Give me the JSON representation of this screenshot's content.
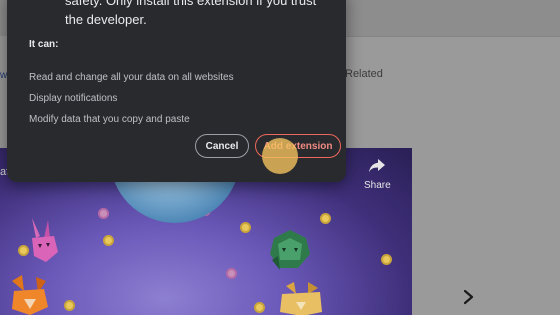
{
  "background_page": {
    "related_label": "Related",
    "left_fragment": "w",
    "video": {
      "title_fragment": "at",
      "share_label": "Share",
      "share_icon": "share-arrow-icon",
      "play_icon": "youtube-play-icon",
      "next_icon": "chevron-right-icon"
    }
  },
  "dialog": {
    "extension_icon": "metamask-fox-icon",
    "warning_text": "safety. Only install this extension if you trust the developer.",
    "permissions_heading": "It can:",
    "permissions": [
      "Read and change all your data on all websites",
      "Display notifications",
      "Modify data that you copy and paste"
    ],
    "cancel_label": "Cancel",
    "add_label": "Add extension"
  },
  "colors": {
    "dialog_bg": "#292a2d",
    "accent_button": "#ee675c",
    "click_indicator": "#f6c45f"
  }
}
